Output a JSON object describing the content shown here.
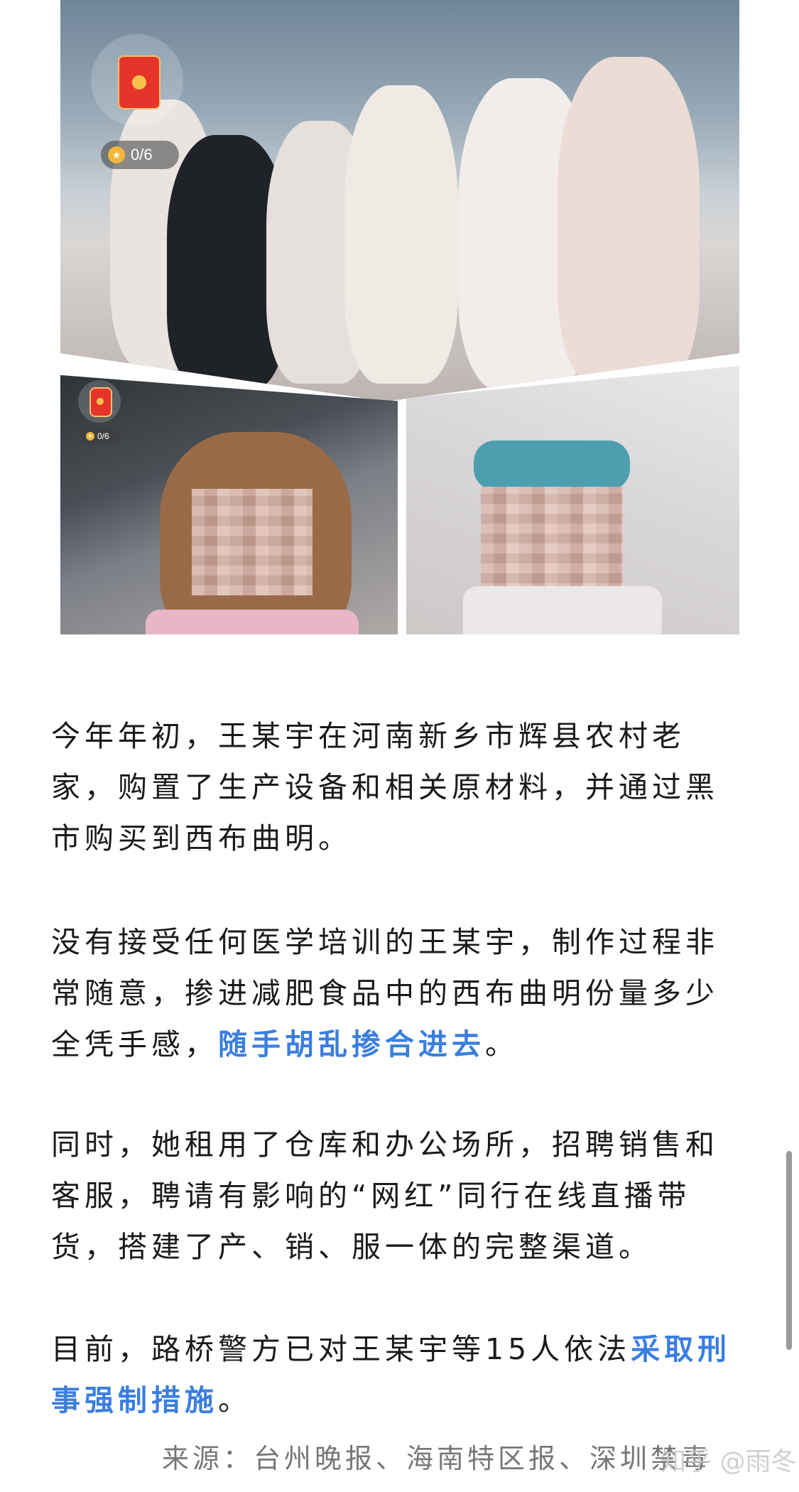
{
  "collage": {
    "top_badge": {
      "counter_text": "0/6"
    },
    "small_badge": {
      "counter_text": "0/6"
    }
  },
  "paragraphs": {
    "p1": "今年年初，王某宇在河南新乡市辉县农村老家，购置了生产设备和相关原材料，并通过黑市购买到西布曲明。",
    "p2_before": "没有接受任何医学培训的王某宇，制作过程非常随意，掺进减肥食品中的西布曲明份量多少全凭手感，",
    "p2_highlight": "随手胡乱掺合进去",
    "p2_after": "。",
    "p3": "同时，她租用了仓库和办公场所，招聘销售和客服，聘请有影响的“网红”同行在线直播带货，搭建了产、销、服一体的完整渠道。",
    "p4_before": "目前，路桥警方已对王某宇等15人依法",
    "p4_highlight": "采取刑事强制措施",
    "p4_after": "。"
  },
  "source_line": "来源：台州晚报、海南特区报、深圳禁毒",
  "watermark": "知乎 @雨冬",
  "colors": {
    "highlight": "#3a7ee0",
    "body_text": "#1a1a1a",
    "source_text": "#777777"
  }
}
